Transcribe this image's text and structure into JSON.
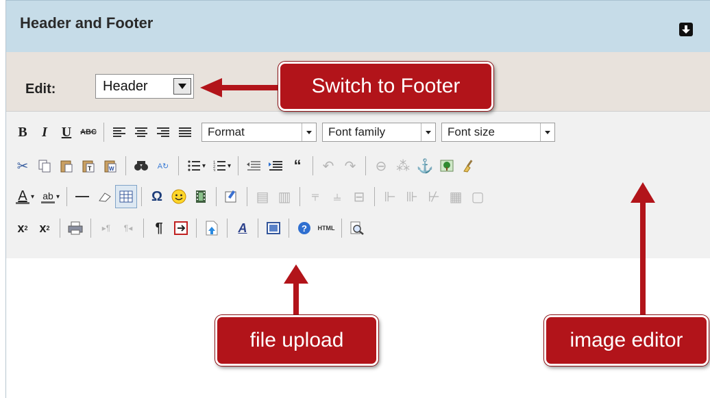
{
  "panel": {
    "title": "Header and Footer"
  },
  "edit": {
    "label": "Edit:",
    "selected": "Header"
  },
  "toolbar": {
    "format_label": "Format",
    "font_family_label": "Font family",
    "font_size_label": "Font size",
    "html_label": "HTML",
    "omega_label": "Ω"
  },
  "callouts": {
    "switch_to_footer": "Switch to Footer",
    "file_upload": "file upload",
    "image_editor": "image editor"
  },
  "colors": {
    "callout_red": "#b2141a",
    "title_bar": "#c6dce8",
    "edit_row": "#e8e2dc",
    "toolbar": "#f1f1f1"
  }
}
